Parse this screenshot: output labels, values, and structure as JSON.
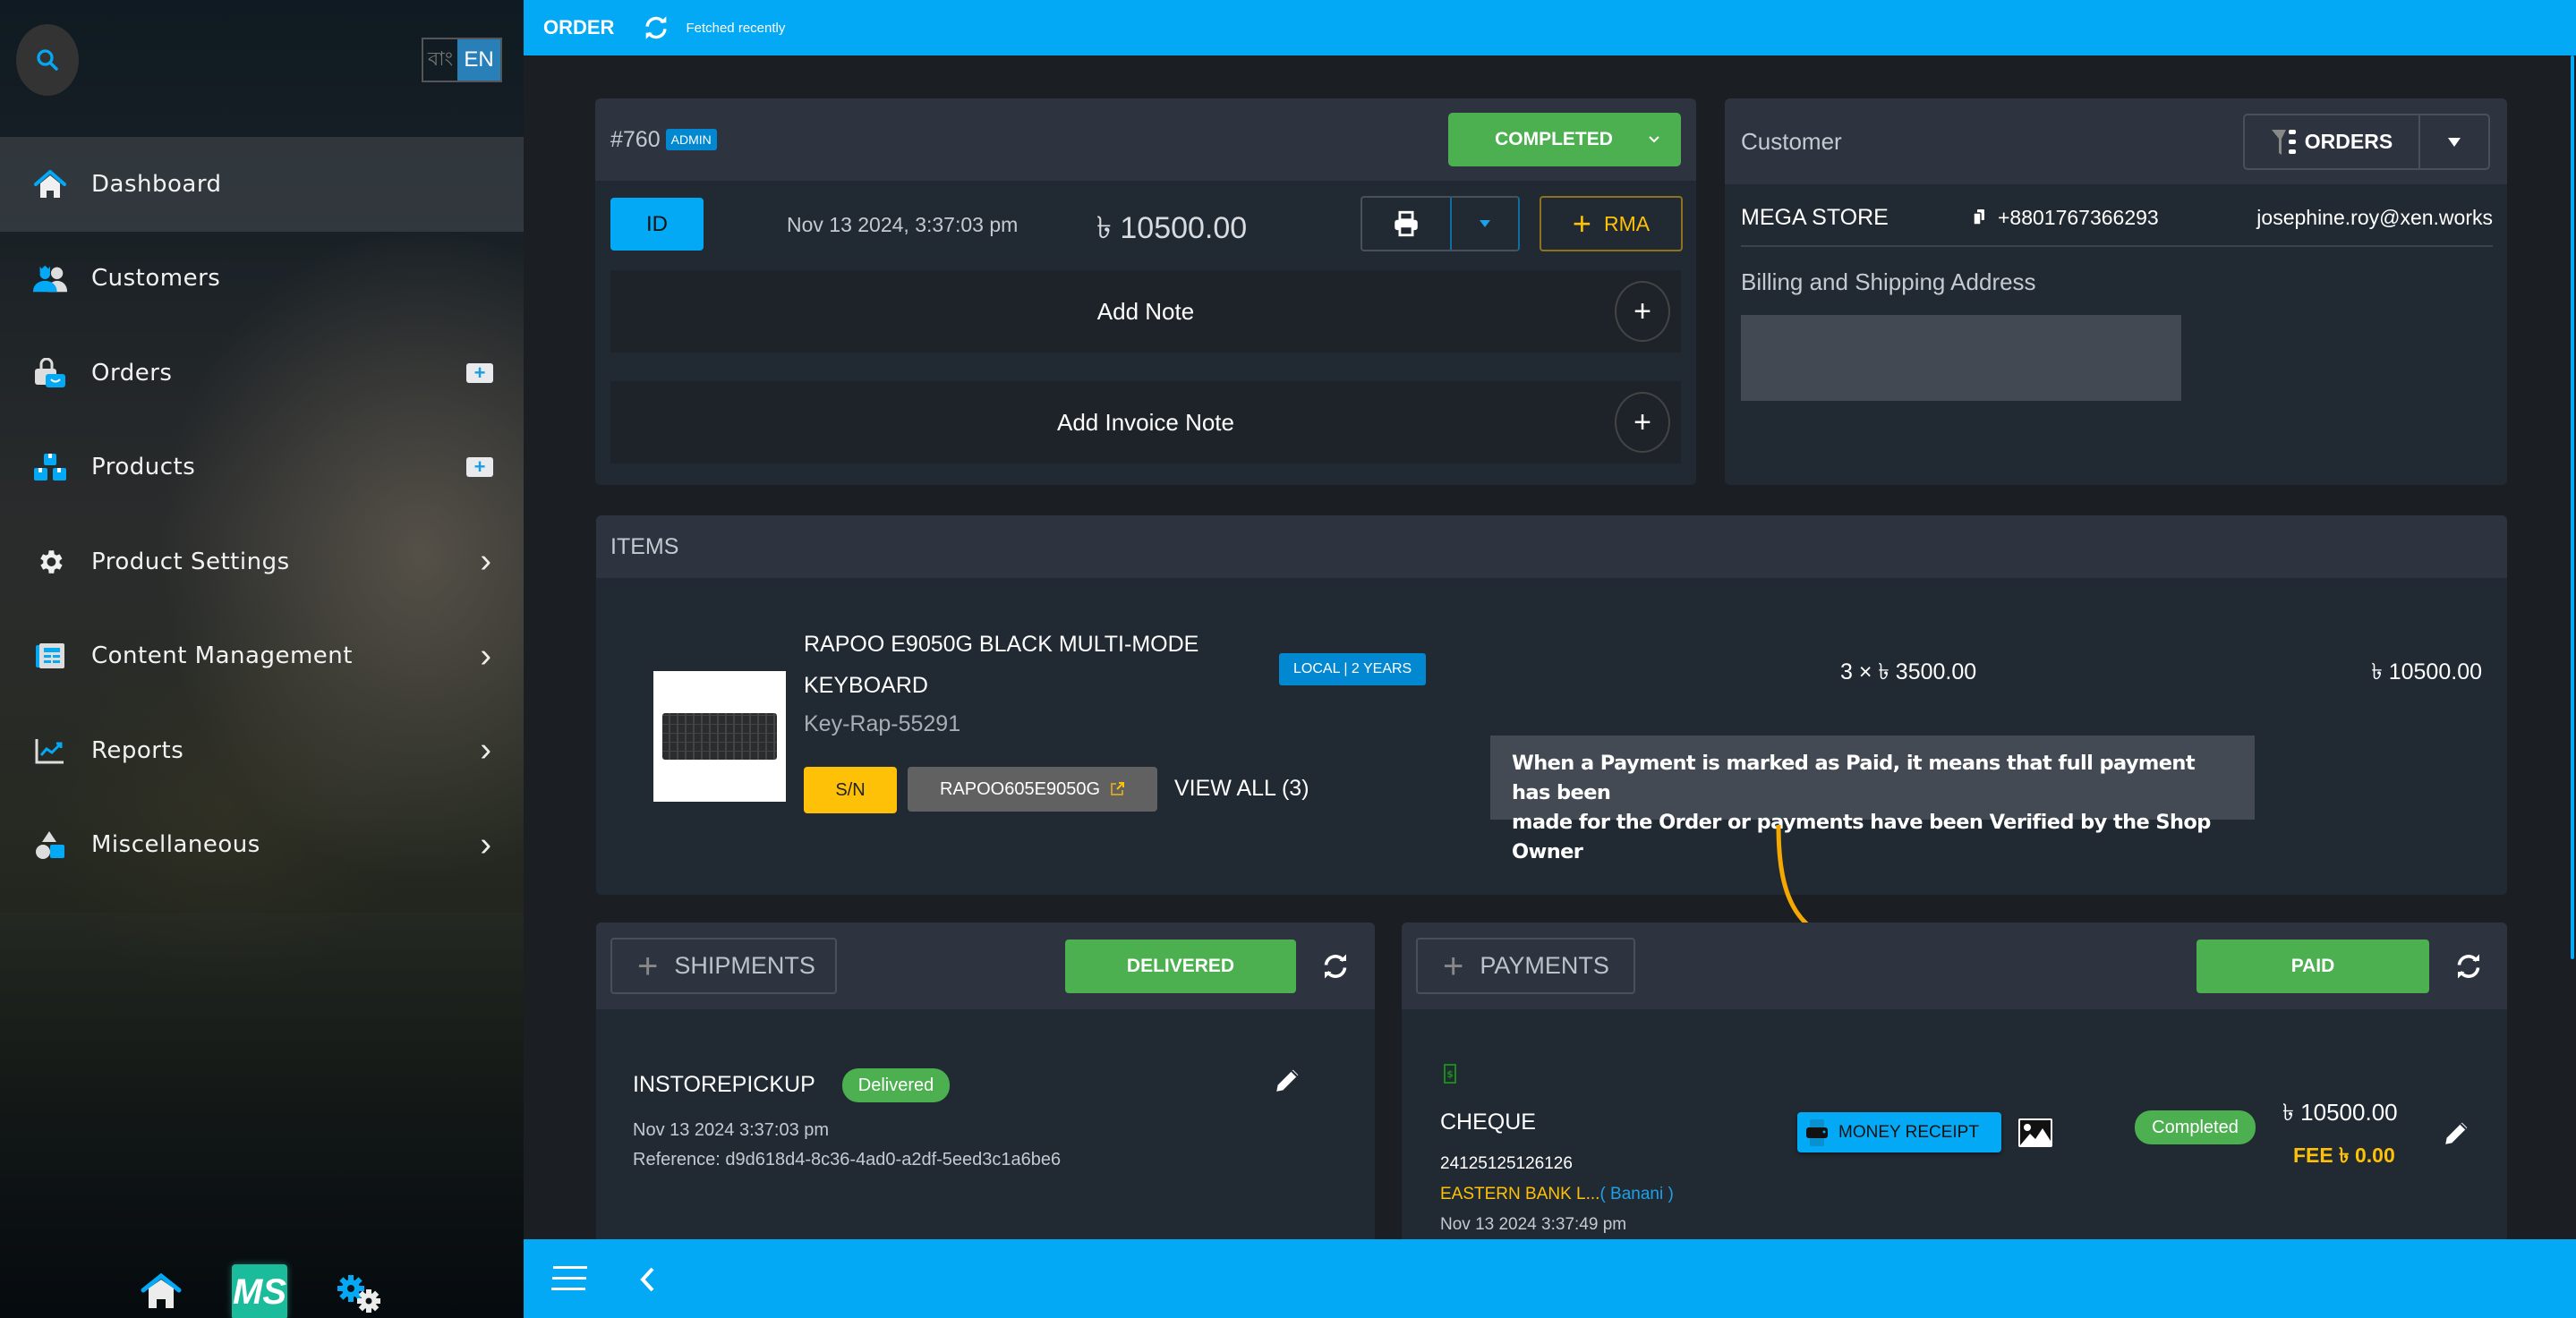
{
  "sidebar": {
    "search_icon": "search-icon",
    "lang_bn": "বাং",
    "lang_en": "EN",
    "items": [
      {
        "label": "Dashboard",
        "icon": "home-icon",
        "active": true
      },
      {
        "label": "Customers",
        "icon": "customers-icon"
      },
      {
        "label": "Orders",
        "icon": "orders-bag-icon",
        "action": "plus"
      },
      {
        "label": "Products",
        "icon": "products-boxes-icon",
        "action": "plus"
      },
      {
        "label": "Product Settings",
        "icon": "gear-icon",
        "action": "chevron"
      },
      {
        "label": "Content Management",
        "icon": "content-icon",
        "action": "chevron"
      },
      {
        "label": "Reports",
        "icon": "chart-icon",
        "action": "chevron"
      },
      {
        "label": "Miscellaneous",
        "icon": "shapes-icon",
        "action": "chevron"
      }
    ],
    "footer": {
      "logo_text": "MS"
    }
  },
  "topbar": {
    "title": "ORDER",
    "fetched": "Fetched recently"
  },
  "order": {
    "number": "#760",
    "source_badge": "ADMIN",
    "status": "COMPLETED",
    "id_button": "ID",
    "date": "Nov 13 2024, 3:37:03 pm",
    "total": "৳ 10500.00",
    "rma_label": "RMA",
    "add_note": "Add Note",
    "add_invoice_note": "Add Invoice Note"
  },
  "customer": {
    "title": "Customer",
    "orders_button": "ORDERS",
    "name": "MEGA STORE",
    "phone": "+8801767366293",
    "email": "josephine.roy@xen.works",
    "address_title": "Billing and Shipping Address"
  },
  "items": {
    "title": "ITEMS",
    "list": [
      {
        "name_line1": "RAPOO E9050G BLACK MULTI-MODE",
        "name_line2": "KEYBOARD",
        "sku": "Key-Rap-55291",
        "warranty": "LOCAL | 2 YEARS",
        "sn_label": "S/N",
        "serial": "RAPOO605E9050G",
        "view_all": "VIEW ALL (3)",
        "qty_price": "3 × ৳ 3500.00",
        "line_total": "৳ 10500.00"
      }
    ]
  },
  "tooltip": {
    "line1": "When a Payment is marked as Paid, it means that full payment has been",
    "line2": "made for the Order or payments have been Verified by the Shop Owner"
  },
  "shipments": {
    "add_label": "SHIPMENTS",
    "status": "DELIVERED",
    "list": [
      {
        "method": "INSTOREPICKUP",
        "status": "Delivered",
        "date": "Nov 13 2024 3:37:03 pm",
        "reference": "Reference: d9d618d4-8c36-4ad0-a2df-5eed3c1a6be6"
      }
    ]
  },
  "payments": {
    "add_label": "PAYMENTS",
    "status": "PAID",
    "list": [
      {
        "method": "CHEQUE",
        "cheque_no": "24125125126126",
        "bank": "EASTERN BANK L...",
        "branch": "( Banani )",
        "date": "Nov 13 2024 3:37:49 pm",
        "receipt_label": "MONEY RECEIPT",
        "status": "Completed",
        "amount": "৳ 10500.00",
        "fee": "FEE ৳ 0.00"
      }
    ]
  },
  "colors": {
    "accent": "#03a9f4",
    "success": "#4caf50",
    "warning": "#ffc107",
    "annotation": "#f5a800"
  }
}
